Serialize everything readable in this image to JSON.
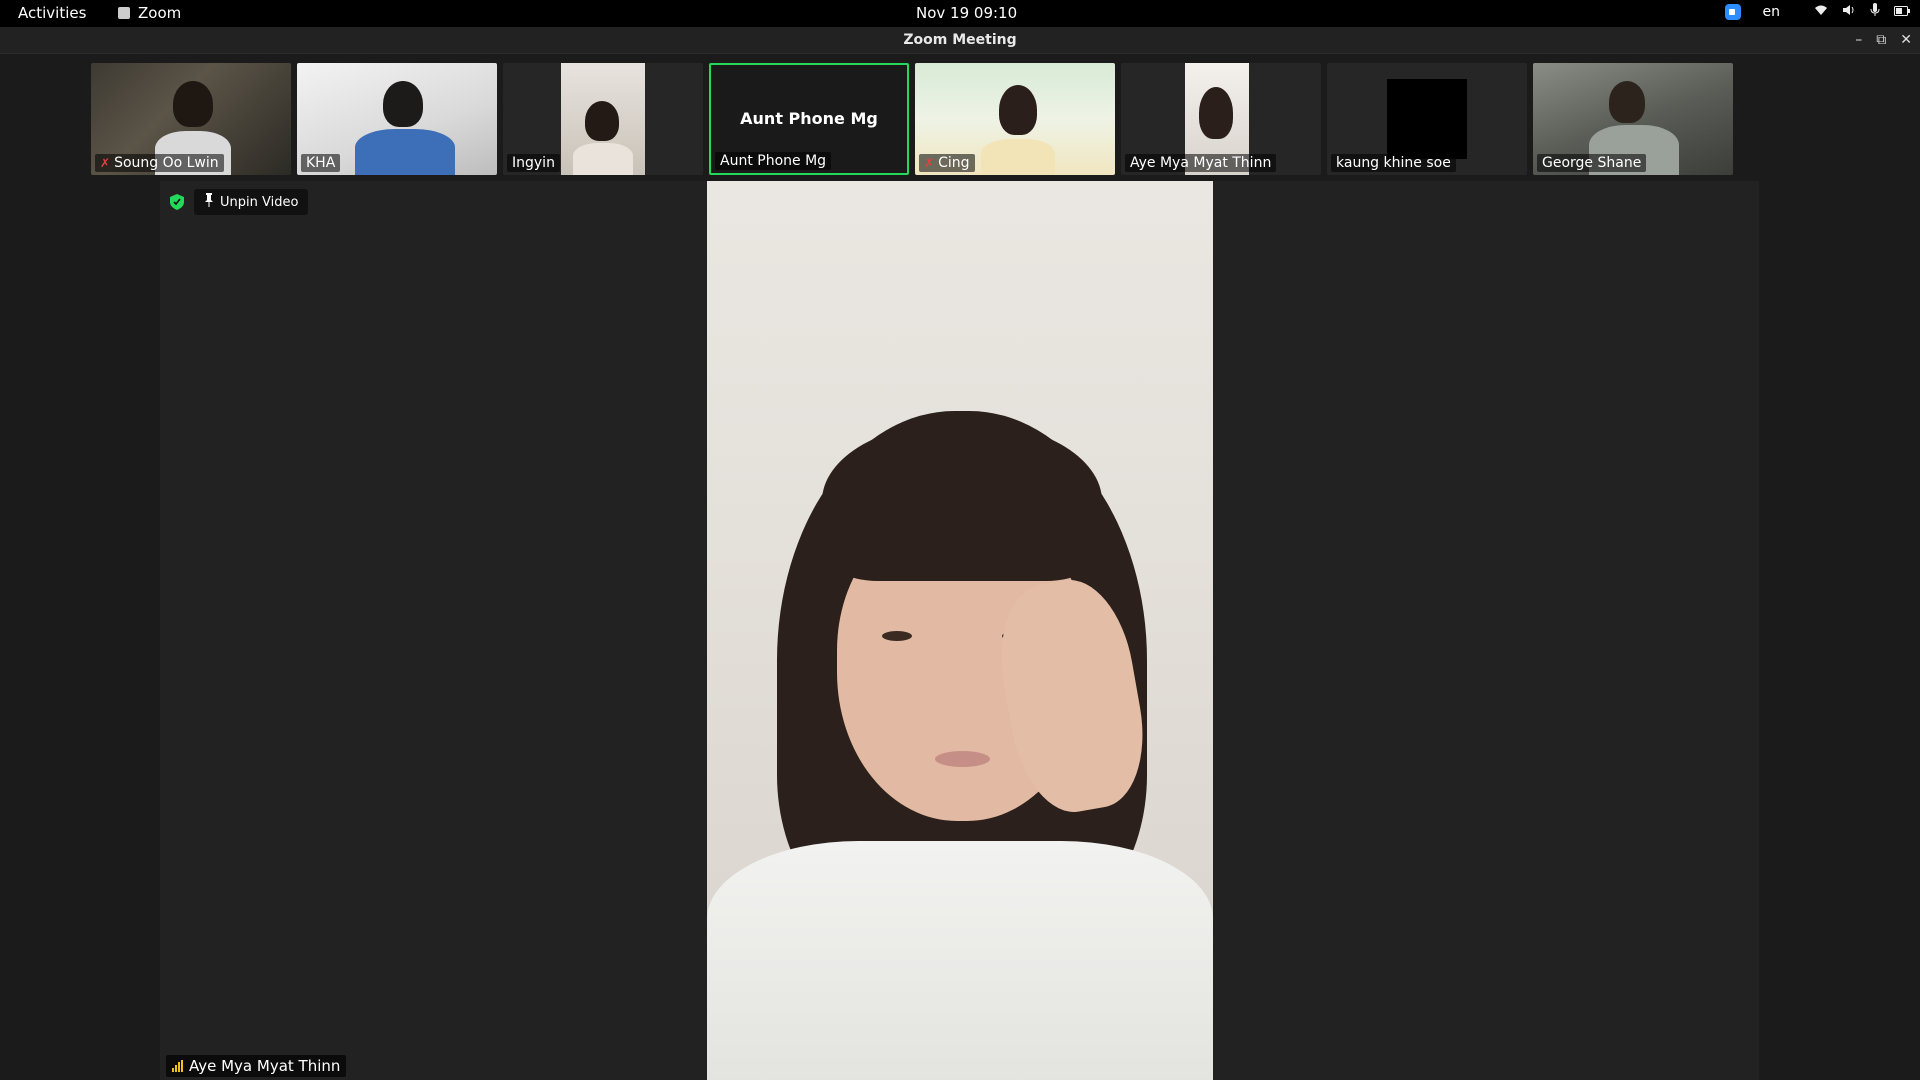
{
  "topbar": {
    "activities": "Activities",
    "app_name": "Zoom",
    "clock": "Nov 19  09:10",
    "lang": "en",
    "tray_icons": [
      "zoom-icon",
      "wifi-icon",
      "volume-icon",
      "microphone-icon",
      "battery-icon"
    ]
  },
  "window": {
    "title": "Zoom Meeting",
    "controls": {
      "minimize": "–",
      "maximize": "⧉",
      "close": "✕"
    }
  },
  "participants": [
    {
      "name": "Soung Oo Lwin",
      "muted": true
    },
    {
      "name": "KHA",
      "muted": false
    },
    {
      "name": "Ingyin",
      "muted": false
    },
    {
      "name": "Aunt Phone Mg",
      "muted": false,
      "video_off": true,
      "active_speaker": true
    },
    {
      "name": "Cing",
      "muted": true
    },
    {
      "name": "Aye Mya Myat Thinn",
      "muted": false
    },
    {
      "name": "kaung khine soe",
      "muted": false
    },
    {
      "name": "George Shane",
      "muted": false
    }
  ],
  "main_video": {
    "unpin_label": "Unpin Video",
    "speaker_name": "Aye Mya Myat Thinn"
  },
  "colors": {
    "active_border": "#23d959",
    "mute_red": "#e04242",
    "signal_yellow": "#f0c419",
    "zoom_blue": "#2d8cff"
  }
}
